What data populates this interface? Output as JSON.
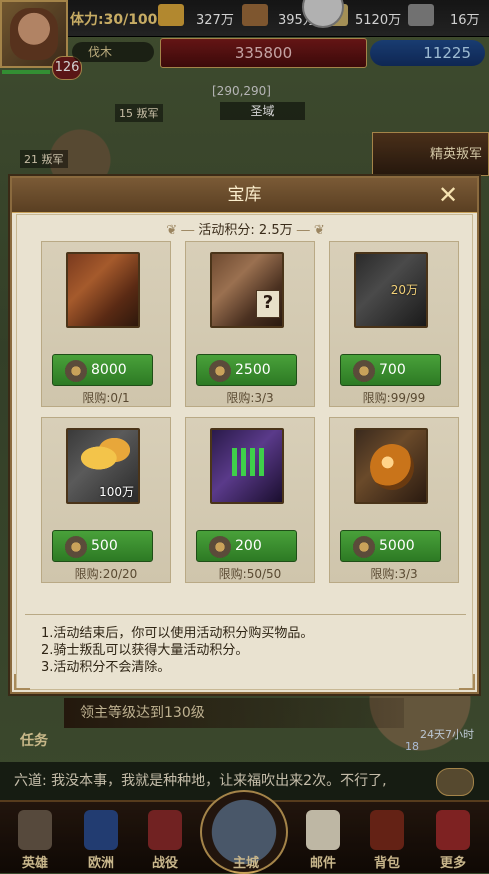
{
  "hud": {
    "stamina": "体力:30/100",
    "resources": [
      {
        "name": "gold-icon",
        "value": "327万",
        "color": "#d9a63a"
      },
      {
        "name": "wood-icon",
        "value": "395万",
        "color": "#9a6a3a"
      },
      {
        "name": "grain-icon",
        "value": "5120万",
        "color": "#c9b06a"
      },
      {
        "name": "iron-icon",
        "value": "16万",
        "color": "#8a8a8a"
      }
    ],
    "level": "126",
    "power": "335800",
    "diamonds": "11225",
    "fell_wood_label": "伐木",
    "coords": "[290,290]",
    "holy_domain": "圣域",
    "map_tags": [
      "15 叛军",
      "21 叛军"
    ],
    "elite_rebels": "精英叛军"
  },
  "dialog": {
    "title": "宝库",
    "close_label": "✕",
    "activity_points": "活动积分: 2.5万",
    "items": [
      {
        "image": "chest",
        "price": "8000",
        "limit": "限购:0/1",
        "overlay": ""
      },
      {
        "image": "mystery-chest",
        "price": "2500",
        "limit": "限购:3/3",
        "overlay": ""
      },
      {
        "image": "book",
        "price": "700",
        "limit": "限购:99/99",
        "overlay": "20万"
      },
      {
        "image": "wheat",
        "price": "500",
        "limit": "限购:20/20",
        "overlay": "100万"
      },
      {
        "image": "purple-chest",
        "price": "200",
        "limit": "限购:50/50",
        "overlay": ""
      },
      {
        "image": "potion",
        "price": "5000",
        "limit": "限购:3/3",
        "overlay": ""
      }
    ],
    "rules": [
      "1.活动结束后，你可以使用活动积分购买物品。",
      "2.骑士叛乱可以获得大量活动积分。",
      "3.活动积分不会清除。"
    ]
  },
  "quest": {
    "text": "领主等级达到130级",
    "task_label": "任务",
    "timer": "24天7小时",
    "count": "18"
  },
  "chat": {
    "message": "六道: 我没本事，我就是种种地，让来福吹出来2次。不行了,"
  },
  "nav": {
    "items": [
      {
        "label": "英雄",
        "icon": "hero-icon"
      },
      {
        "label": "欧洲",
        "icon": "europe-icon"
      },
      {
        "label": "战役",
        "icon": "campaign-icon"
      },
      {
        "label": "主城",
        "icon": "main-city-icon"
      },
      {
        "label": "邮件",
        "icon": "mail-icon"
      },
      {
        "label": "背包",
        "icon": "backpack-icon"
      },
      {
        "label": "更多",
        "icon": "more-icon"
      }
    ]
  }
}
